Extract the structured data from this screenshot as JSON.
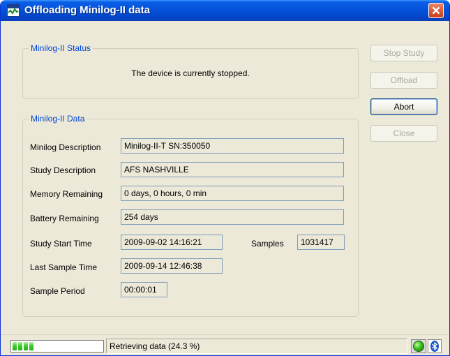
{
  "window": {
    "title": "Offloading Minilog-II data"
  },
  "status_group": {
    "legend": "Minilog-II Status",
    "message": "The device is currently stopped."
  },
  "data_group": {
    "legend": "Minilog-II Data",
    "minilog_description": {
      "label": "Minilog Description",
      "value": "Minilog-II-T SN:350050"
    },
    "study_description": {
      "label": "Study Description",
      "value": "AFS NASHVILLE"
    },
    "memory_remaining": {
      "label": "Memory Remaining",
      "value": "0 days, 0 hours, 0 min"
    },
    "battery_remaining": {
      "label": "Battery Remaining",
      "value": "254 days"
    },
    "study_start_time": {
      "label": "Study Start Time",
      "value": "2009-09-02 14:16:21"
    },
    "samples": {
      "label": "Samples",
      "value": "1031417"
    },
    "last_sample_time": {
      "label": "Last Sample Time",
      "value": "2009-09-14 12:46:38"
    },
    "sample_period": {
      "label": "Sample Period",
      "value": "00:00:01"
    }
  },
  "buttons": {
    "stop_study": {
      "label": "Stop Study",
      "enabled": false
    },
    "offload": {
      "label": "Offload",
      "enabled": false
    },
    "abort": {
      "label": "Abort",
      "enabled": true
    },
    "close": {
      "label": "Close",
      "enabled": false
    }
  },
  "statusbar": {
    "progress_percent": 24.3,
    "text": "Retrieving data (24.3 %)",
    "connection_icon": "green-led-icon",
    "bluetooth_icon": "bluetooth-icon"
  },
  "colors": {
    "title_bar": "#0453da",
    "legend_text": "#0046d5",
    "progress_fill": "#3fcc2f",
    "close_button": "#e05c38"
  }
}
